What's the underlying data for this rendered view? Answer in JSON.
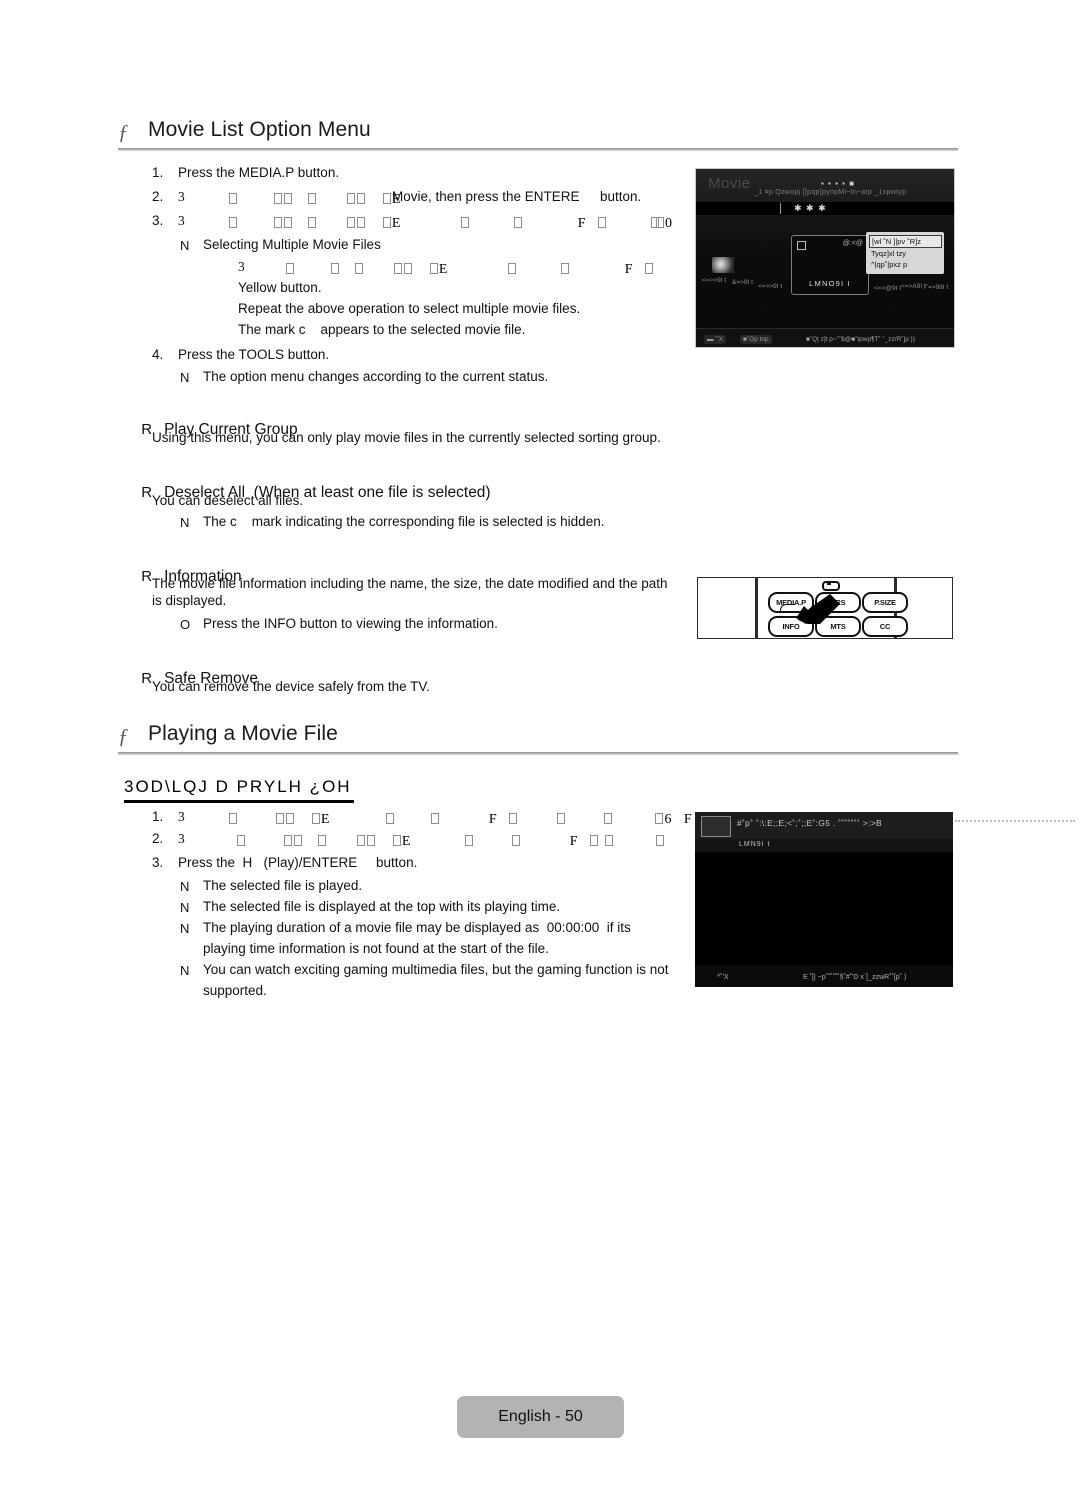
{
  "document": {
    "footer_label": "English - 50"
  },
  "section1": {
    "marker": "ƒ",
    "title": "Movie List Option Menu",
    "steps": [
      {
        "num": "1.",
        "text": "Press the MEDIA.P button."
      },
      {
        "num": "2.",
        "text_before": "",
        "garbled_head": "3",
        "text_mid": "Movie",
        "text_after": ", then press the ENTERE",
        "text_tail": "button."
      },
      {
        "num": "3.",
        "garbled_head": "3",
        "garbled_tail": "0"
      },
      {
        "num": "4.",
        "text": "Press the TOOLS button."
      }
    ],
    "step1_label": "Press the MEDIA.P button.",
    "step2_movie_word": "Movie",
    "step2_tail": ", then press the ENTERE",
    "step2_end": "button.",
    "step4_label": "Press the TOOLS button.",
    "note_multi_title": "Selecting Multiple Movie Files",
    "note_yellow": "Yellow button.",
    "note_repeat": "Repeat the above operation to select multiple movie files.",
    "note_mark": "The mark c    appears to the selected movie file.",
    "note_tools": "The option menu changes according to the current status.",
    "note_symbol": "N"
  },
  "options": [
    {
      "bullet": "R",
      "title": "Play Current Group",
      "body": "Using this menu, you can only play movie files in the currently selected sorting group.",
      "notes": []
    },
    {
      "bullet": "R",
      "title": "Deselect All  (When at least one file is selected)",
      "body": "You can deselect all files.",
      "notes": [
        {
          "mark": "N",
          "text": "The c    mark indicating the corresponding file is selected is hidden."
        }
      ]
    },
    {
      "bullet": "R",
      "title": "Information",
      "body": "The movie file information including the name, the size, the date modified and the path",
      "body2": "is displayed.",
      "notes": [
        {
          "mark": "O",
          "text": "Press the INFO button to viewing the information."
        }
      ]
    },
    {
      "bullet": "R",
      "title": "Safe Remove",
      "body": "You can remove the device safely from the TV.",
      "notes": []
    }
  ],
  "section2": {
    "marker": "ƒ",
    "title": "Playing a Movie File",
    "subheading": "3OD\\LQJ D PRYLH ¿OH",
    "steps": [
      {
        "num": "1.",
        "garbled_head": "3",
        "garbled_tail": "6"
      },
      {
        "num": "2.",
        "garbled_head": "3"
      },
      {
        "num": "3.",
        "text": "Press the  H   (Play)/ENTERE     button."
      }
    ],
    "step3_label": "Press the  H   (Play)/ENTERE     button.",
    "notes": [
      {
        "mark": "N",
        "text": "The selected file is played."
      },
      {
        "mark": "N",
        "text": "The selected file is displayed at the top with its playing time."
      },
      {
        "mark": "N",
        "text": "The playing duration of a movie file may be displayed as  00:00:00  if its"
      },
      {
        "mark": "",
        "text": "playing time information is not found at the start of the file."
      },
      {
        "mark": "N",
        "text": "You can watch exciting gaming multimedia files, but the gaming function is not"
      },
      {
        "mark": "",
        "text": "supported."
      }
    ]
  },
  "figure_movie_list": {
    "title": "Movie",
    "header_junk": "_1 ¤p    Qzwopj    []pqp]pynpMi~tn~atp _1xpwtyp",
    "header_dots": "▪ ▪ ▪ ▪ ■",
    "bar_dots": "✱ ✱ ✱",
    "panel_code": "@:<@",
    "panel_name": "LMNO9I I",
    "menu_items": [
      "[wl ˚N ]|pv ˚R]z",
      "Tyqz]xl tzy",
      "^|qp˚|pxz p"
    ],
    "row_labels": [
      "<=>>9I t",
      "&=>9I t",
      "<=>>9I t",
      "<=>@9I t",
      "<=>A9I t",
      "f˚=>99I t"
    ],
    "footer_chip1": "▬ ˚'X",
    "footer_chip2": "■˚Öp tnp",
    "footer_text": "■˚Q| z]t p~˚˚$@■˚tpwp¶T˚ ˚_zz/R˚]p  }}"
  },
  "figure_remote": {
    "buttons_top": [
      "MEDIA.P",
      "SRS",
      "P.SIZE"
    ],
    "buttons_bottom": [
      "INFO",
      "MTS",
      "CC"
    ],
    "pointer_target": "INFO"
  },
  "figure_playback": {
    "topbar_text": "#˚p˚ ˚:\\:E;;E;<˚;˚;;E˚:G5 . ˚˚˚˚˚˚˚ >:>B",
    "subbar_text": "LMN9I t",
    "bottom_left": "^˚'X",
    "bottom_right": "E  ˚[| ~p˚˚˚˚˚˚§˚#˚'D  x´[_zzwR˚˚[p˚ )"
  },
  "colors": {
    "rule": "#9a9a9a",
    "footer_bg": "#b3b3b3",
    "text": "#111111",
    "tofu_border": "#8d8d8d"
  }
}
